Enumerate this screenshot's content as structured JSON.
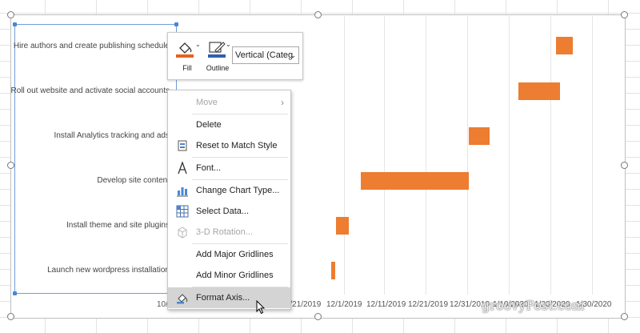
{
  "chart": {
    "tasks": [
      "Hire authors and create publishing schedule",
      "Roll out website and activate social accounts",
      "Install Analytics tracking and ads",
      "Develop site content",
      "Install theme and site plugins",
      "Launch new wordpress installation"
    ],
    "x_ticks_visible": [
      "10/",
      "11/21/2019",
      "12/1/2019",
      "12/11/2019",
      "12/21/2019",
      "12/31/2019",
      "1/10/2020",
      "1/20/2020",
      "1/30/2020"
    ],
    "bar_color": "#ed7d31"
  },
  "chart_data": {
    "type": "bar",
    "orientation": "horizontal-gantt",
    "categories": [
      "Hire authors and create publishing schedule",
      "Roll out website and activate social accounts",
      "Install Analytics tracking and ads",
      "Develop site content",
      "Install theme and site plugins",
      "Launch new wordpress installation"
    ],
    "series": [
      {
        "start": [
          "2020-01-21",
          "2020-01-12",
          "2019-12-31",
          "2019-12-05",
          "2019-11-29",
          "2019-11-28"
        ],
        "end": [
          "2020-01-25",
          "2020-01-22",
          "2020-01-05",
          "2019-12-31",
          "2019-12-02",
          "2019-11-29"
        ]
      }
    ],
    "x_tick_labels": [
      "11/21/2019",
      "12/1/2019",
      "12/11/2019",
      "12/21/2019",
      "12/31/2019",
      "1/10/2020",
      "1/20/2020",
      "1/30/2020"
    ],
    "gridlines": true
  },
  "mini_toolbar": {
    "fill_label": "Fill",
    "outline_label": "Outline",
    "element_selector": "Vertical (Categ",
    "caret": "⌄",
    "fill_accent": "#e8601f",
    "outline_accent": "#2f5fb3"
  },
  "context_menu": {
    "items": [
      {
        "label": "Move",
        "enabled": false,
        "submenu": true
      },
      {
        "label": "Delete",
        "enabled": true
      },
      {
        "label": "Reset to Match Style",
        "enabled": true
      },
      {
        "label": "Font...",
        "enabled": true
      },
      {
        "label": "Change Chart Type...",
        "enabled": true
      },
      {
        "label": "Select Data...",
        "enabled": true
      },
      {
        "label": "3-D Rotation...",
        "enabled": false
      },
      {
        "label": "Add Major Gridlines",
        "enabled": true
      },
      {
        "label": "Add Minor Gridlines",
        "enabled": true
      },
      {
        "label": "Format Axis...",
        "enabled": true,
        "highlighted": true
      }
    ],
    "submenu_arrow": "›"
  },
  "watermark": "groovyPost.com"
}
